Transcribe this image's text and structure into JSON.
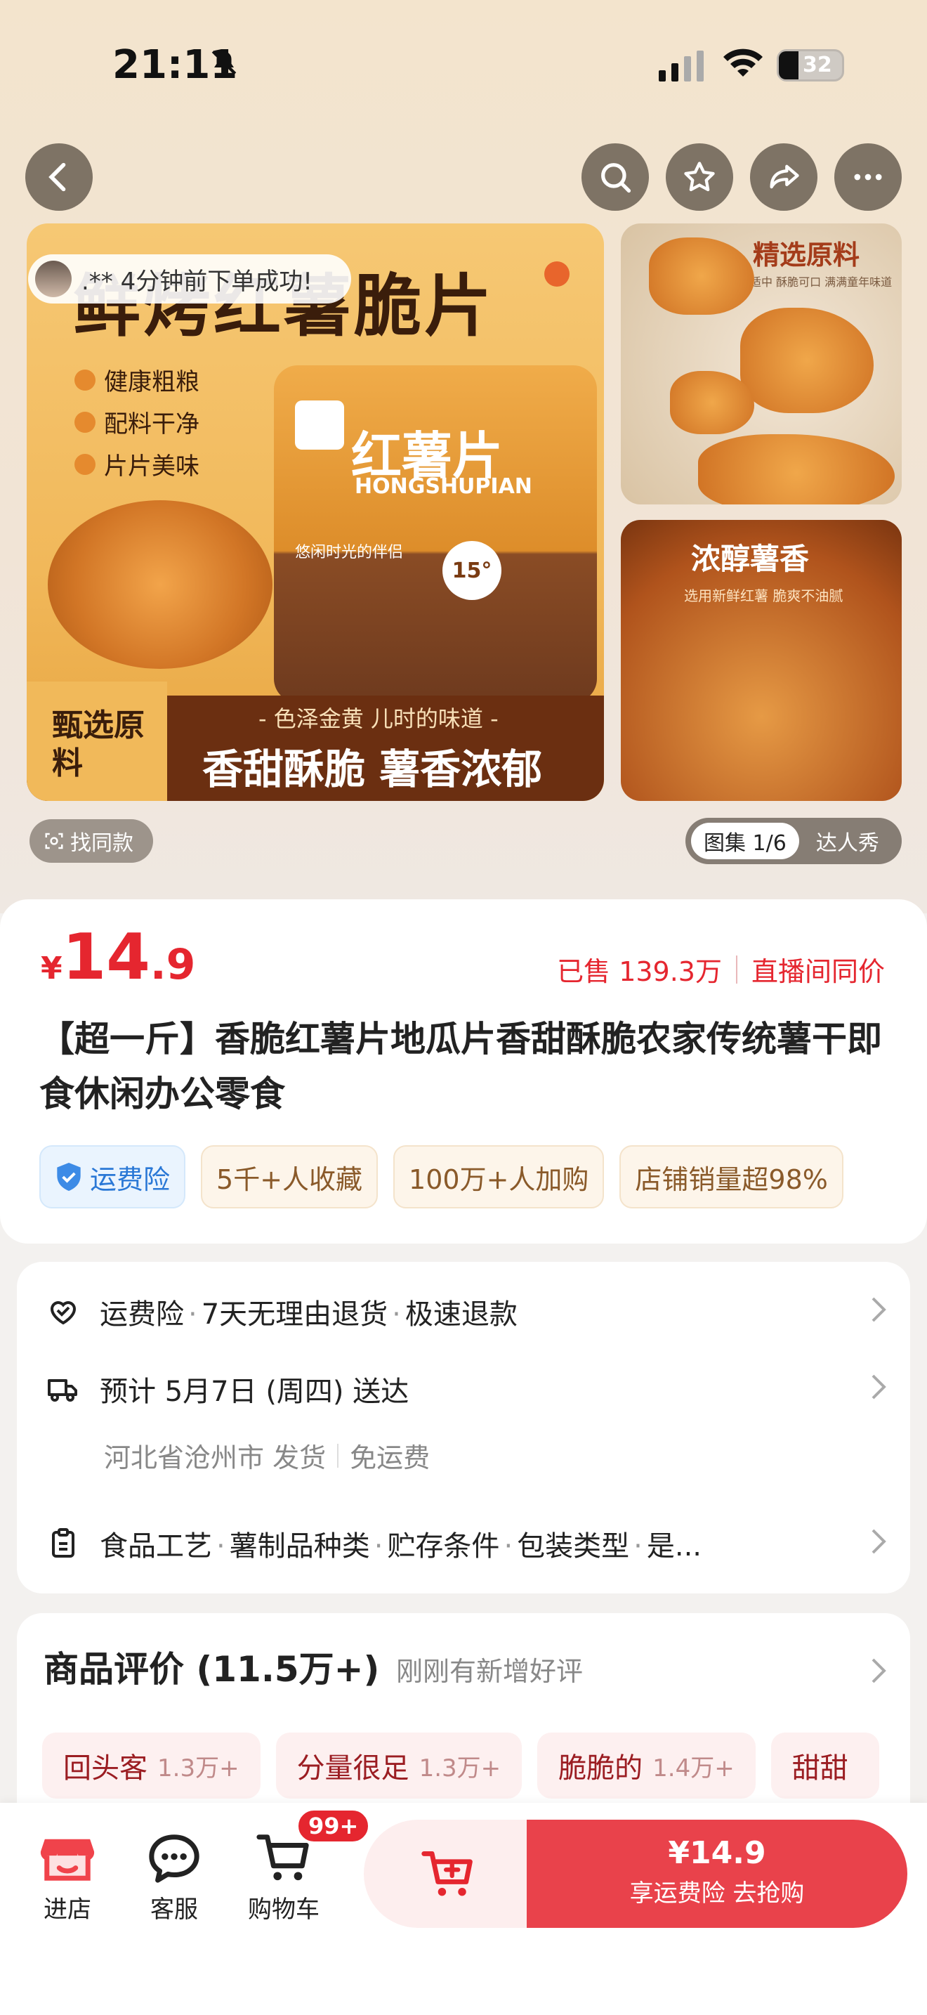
{
  "status_bar": {
    "time": "21:11",
    "battery": "32"
  },
  "gallery": {
    "notification": ".** 4分钟前下单成功!",
    "main_title": "鲜烤红薯脆片",
    "features": [
      "健康粗粮",
      "配料干净",
      "片片美味"
    ],
    "bag_title": "红薯片",
    "bag_subtitle": "HONGSHUPIAN",
    "bag_tagline": "悠闲时光的伴侣",
    "bag_seal": "15°",
    "banner_left": "甄选原料",
    "banner_sub": "- 色泽金黄 儿时的味道 -",
    "banner_main": "香甜酥脆 薯香浓郁",
    "side1_title": "精选原料",
    "side1_sub": "入口甜度适中 酥脆可口 满满童年味道",
    "side2_title": "浓醇薯香",
    "side2_sub": "选用新鲜红薯 脆爽不油腻",
    "find_similar": "找同款",
    "gallery_tab": "图集 1/6",
    "buyer_show_tab": "达人秀"
  },
  "product": {
    "currency": "¥",
    "price_int": "14",
    "price_dec": ".9",
    "sold": "已售 139.3万",
    "live_same_price": "直播间同价",
    "title": "【超一斤】香脆红薯片地瓜片香甜酥脆农家传统薯干即食休闲办公零食",
    "tags": [
      "运费险",
      "5千+人收藏",
      "100万+人加购",
      "店铺销量超98%"
    ]
  },
  "service": {
    "guarantee": [
      "运费险",
      "7天无理由退货",
      "极速退款"
    ],
    "delivery": "预计 5月7日 (周四) 送达",
    "ship_from": "河北省沧州市 发货",
    "shipping_fee": "免运费",
    "params": [
      "食品工艺",
      "薯制品种类",
      "贮存条件",
      "包装类型",
      "是..."
    ]
  },
  "reviews": {
    "title": "商品评价 (11.5万+)",
    "subtitle": "刚刚有新增好评",
    "tags": [
      {
        "label": "回头客",
        "count": "1.3万+"
      },
      {
        "label": "分量很足",
        "count": "1.3万+"
      },
      {
        "label": "脆脆的",
        "count": "1.4万+"
      },
      {
        "label": "甜甜",
        "count": ""
      }
    ]
  },
  "bottom_bar": {
    "shop": "进店",
    "service": "客服",
    "cart": "购物车",
    "cart_badge": "99+",
    "buy_price": "¥14.9",
    "buy_label": "享运费险  去抢购"
  },
  "colors": {
    "accent": "#e5262f",
    "buy_button": "#e9424b",
    "blue_tag": "#2a78d6"
  }
}
